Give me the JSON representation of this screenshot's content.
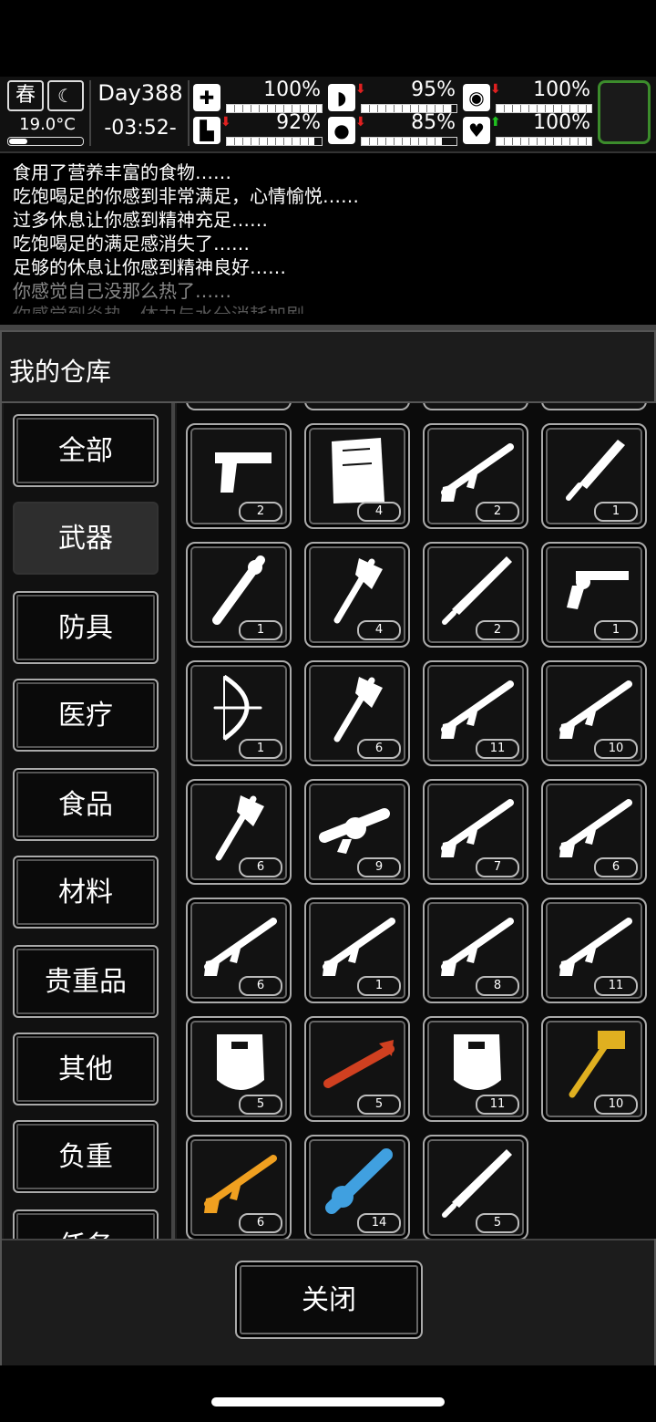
{
  "status": {
    "season": "春",
    "temperature": "19.0°C",
    "day": "Day388",
    "time": "-03:52-",
    "stats": [
      {
        "name": "health",
        "icon": "medkit-icon",
        "glyph": "✚",
        "value": "100%",
        "level": 1.0,
        "arrow": ""
      },
      {
        "name": "hunger",
        "icon": "stomach-icon",
        "glyph": "◗",
        "value": "95%",
        "level": 0.95,
        "arrow": "down"
      },
      {
        "name": "medicine",
        "icon": "pill-icon",
        "glyph": "◉",
        "value": "100%",
        "level": 1.0,
        "arrow": "down"
      },
      {
        "name": "stamina",
        "icon": "boot-icon",
        "glyph": "▙",
        "value": "92%",
        "level": 0.92,
        "arrow": "down"
      },
      {
        "name": "thirst",
        "icon": "water-drop-icon",
        "glyph": "●",
        "value": "85%",
        "level": 0.85,
        "arrow": "down"
      },
      {
        "name": "mood",
        "icon": "heart-icon",
        "glyph": "♥",
        "value": "100%",
        "level": 1.0,
        "arrow": "up"
      }
    ],
    "arrow_colors": {
      "down": "#e02020",
      "up": "#20c020"
    },
    "slot_color": "#3c8c2c"
  },
  "log": [
    "食用了营养丰富的食物……",
    "吃饱喝足的你感到非常满足，心情愉悦……",
    "过多休息让你感到精神充足……",
    "吃饱喝足的满足感消失了……",
    "足够的休息让你感到精神良好……",
    "你感觉自己没那么热了……",
    "你感觉到炎热，体力与水分消耗加剧……"
  ],
  "panel": {
    "title": "我的仓库",
    "categories": [
      "全部",
      "武器",
      "防具",
      "医疗",
      "食品",
      "材料",
      "贵重品",
      "其他",
      "负重",
      "任务"
    ],
    "active_category": 1,
    "close_label": "关闭"
  },
  "items": [
    {
      "name": "pistol",
      "icon": "pistol-icon",
      "count": "2",
      "color": "#ffffff"
    },
    {
      "name": "map",
      "icon": "map-icon",
      "count": "4",
      "color": "#ffffff"
    },
    {
      "name": "rifle",
      "icon": "rifle-icon",
      "count": "2",
      "color": "#ffffff"
    },
    {
      "name": "machete",
      "icon": "machete-icon",
      "count": "1",
      "color": "#ffffff"
    },
    {
      "name": "spiked-club",
      "icon": "spiked-club-icon",
      "count": "1",
      "color": "#ffffff"
    },
    {
      "name": "hatchet",
      "icon": "hatchet-icon",
      "count": "4",
      "color": "#ffffff"
    },
    {
      "name": "sword",
      "icon": "sword-icon",
      "count": "2",
      "color": "#ffffff"
    },
    {
      "name": "revolver",
      "icon": "revolver-icon",
      "count": "1",
      "color": "#ffffff"
    },
    {
      "name": "bow",
      "icon": "bow-icon",
      "count": "1",
      "color": "#ffffff"
    },
    {
      "name": "fire-axe",
      "icon": "fire-axe-icon",
      "count": "6",
      "color": "#ffffff"
    },
    {
      "name": "bolt-rifle",
      "icon": "bolt-rifle-icon",
      "count": "11",
      "color": "#ffffff"
    },
    {
      "name": "hunting-rifle",
      "icon": "hunting-rifle-icon",
      "count": "10",
      "color": "#ffffff"
    },
    {
      "name": "axe",
      "icon": "axe-icon",
      "count": "6",
      "color": "#ffffff"
    },
    {
      "name": "grenade-launcher",
      "icon": "grenade-launcher-icon",
      "count": "9",
      "color": "#ffffff"
    },
    {
      "name": "shotgun",
      "icon": "shotgun-icon",
      "count": "7",
      "color": "#ffffff"
    },
    {
      "name": "carbine",
      "icon": "carbine-icon",
      "count": "6",
      "color": "#ffffff"
    },
    {
      "name": "assault-rifle",
      "icon": "assault-rifle-icon",
      "count": "6",
      "color": "#ffffff"
    },
    {
      "name": "tactical-rifle",
      "icon": "tactical-rifle-icon",
      "count": "1",
      "color": "#ffffff"
    },
    {
      "name": "pump-shotgun",
      "icon": "pump-shotgun-icon",
      "count": "8",
      "color": "#ffffff"
    },
    {
      "name": "battle-rifle",
      "icon": "battle-rifle-icon",
      "count": "11",
      "color": "#ffffff"
    },
    {
      "name": "riot-shield",
      "icon": "riot-shield-icon",
      "count": "5",
      "color": "#ffffff"
    },
    {
      "name": "rocket-launcher",
      "icon": "rocket-launcher-icon",
      "count": "5",
      "color": "#d04020"
    },
    {
      "name": "armored-shield",
      "icon": "armored-shield-icon",
      "count": "11",
      "color": "#ffffff"
    },
    {
      "name": "war-hammer",
      "icon": "war-hammer-icon",
      "count": "10",
      "color": "#e0b020"
    },
    {
      "name": "blaster-gun",
      "icon": "blaster-gun-icon",
      "count": "6",
      "color": "#f0a020"
    },
    {
      "name": "minigun",
      "icon": "minigun-icon",
      "count": "14",
      "color": "#40a0e0"
    },
    {
      "name": "great-sword",
      "icon": "great-sword-icon",
      "count": "5",
      "color": "#ffffff"
    }
  ]
}
